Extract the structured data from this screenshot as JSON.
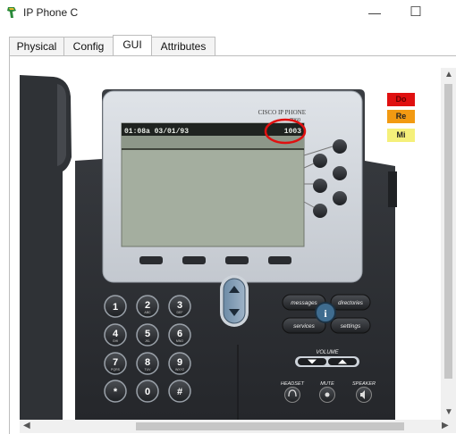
{
  "window": {
    "title": "IP Phone C",
    "minimize_glyph": "—",
    "maximize_glyph": "☐"
  },
  "tabs": [
    {
      "label": "Physical"
    },
    {
      "label": "Config"
    },
    {
      "label": "GUI"
    },
    {
      "label": "Attributes"
    }
  ],
  "phone": {
    "brand": "CISCO IP PHONE",
    "model": "7960",
    "screen": {
      "datetime": "01:08a 03/01/93",
      "extension": "1003"
    },
    "indicators": [
      {
        "label": "Do",
        "color": "#e01010"
      },
      {
        "label": "Re",
        "color": "#f29a12"
      },
      {
        "label": "Mi",
        "color": "#f5f07a"
      }
    ],
    "keypad": [
      {
        "num": "1",
        "sub": ""
      },
      {
        "num": "2",
        "sub": "ABC"
      },
      {
        "num": "3",
        "sub": "DEF"
      },
      {
        "num": "4",
        "sub": "GHI"
      },
      {
        "num": "5",
        "sub": "JKL"
      },
      {
        "num": "6",
        "sub": "MNO"
      },
      {
        "num": "7",
        "sub": "PQRS"
      },
      {
        "num": "8",
        "sub": "TUV"
      },
      {
        "num": "9",
        "sub": "WXYZ"
      },
      {
        "num": "*",
        "sub": ""
      },
      {
        "num": "0",
        "sub": ""
      },
      {
        "num": "#",
        "sub": ""
      }
    ],
    "buttons": {
      "messages": "messages",
      "directories": "directories",
      "services": "services",
      "settings": "settings",
      "info": "i",
      "volume": "VOLUME",
      "headset": "HEADSET",
      "mute": "MUTE",
      "speaker": "SPEAKER"
    },
    "highlight_color": "#e01010"
  }
}
